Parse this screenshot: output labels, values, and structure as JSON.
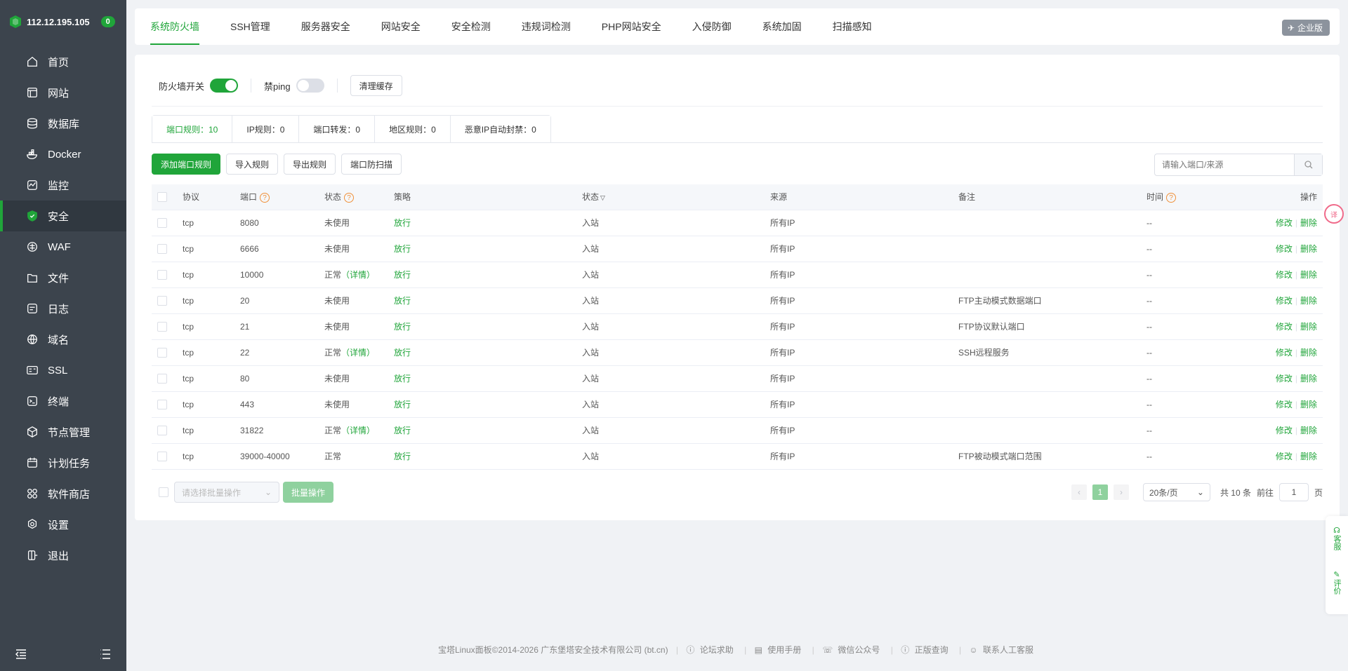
{
  "sidebar": {
    "ip": "112.12.195.105",
    "badge": "0",
    "items": [
      {
        "label": "首页",
        "icon": "home-icon"
      },
      {
        "label": "网站",
        "icon": "website-icon"
      },
      {
        "label": "数据库",
        "icon": "database-icon"
      },
      {
        "label": "Docker",
        "icon": "docker-icon"
      },
      {
        "label": "监控",
        "icon": "monitor-icon"
      },
      {
        "label": "安全",
        "icon": "shield-icon",
        "active": true
      },
      {
        "label": "WAF",
        "icon": "waf-icon"
      },
      {
        "label": "文件",
        "icon": "folder-icon"
      },
      {
        "label": "日志",
        "icon": "log-icon"
      },
      {
        "label": "域名",
        "icon": "globe-icon"
      },
      {
        "label": "SSL",
        "icon": "ssl-icon"
      },
      {
        "label": "终端",
        "icon": "terminal-icon"
      },
      {
        "label": "节点管理",
        "icon": "node-icon"
      },
      {
        "label": "计划任务",
        "icon": "calendar-icon"
      },
      {
        "label": "软件商店",
        "icon": "apps-icon"
      },
      {
        "label": "设置",
        "icon": "gear-icon"
      },
      {
        "label": "退出",
        "icon": "logout-icon"
      }
    ]
  },
  "topbar": {
    "tabs": [
      "系统防火墙",
      "SSH管理",
      "服务器安全",
      "网站安全",
      "安全检测",
      "违规词检测",
      "PHP网站安全",
      "入侵防御",
      "系统加固",
      "扫描感知"
    ],
    "active_tab": 0,
    "enterprise_label": "企业版"
  },
  "firewall": {
    "switch_label": "防火墙开关",
    "switch_on": true,
    "ping_label": "禁ping",
    "ping_on": false,
    "clear_cache": "清理缓存"
  },
  "subtabs": [
    "端口规则：10",
    "IP规则：0",
    "端口转发：0",
    "地区规则：0",
    "恶意IP自动封禁：0"
  ],
  "actions": {
    "add": "添加端口规则",
    "import": "导入规则",
    "export": "导出规则",
    "scan": "端口防扫描",
    "search_placeholder": "请输入端口/来源"
  },
  "table": {
    "headers": {
      "protocol": "协议",
      "port": "端口",
      "status": "状态",
      "policy": "策略",
      "direction": "状态",
      "source": "来源",
      "remark": "备注",
      "time": "时间",
      "ops": "操作"
    },
    "rows": [
      {
        "protocol": "tcp",
        "port": "8080",
        "status": "未使用",
        "detail": "",
        "policy": "放行",
        "direction": "入站",
        "source": "所有IP",
        "remark": "",
        "time": "--"
      },
      {
        "protocol": "tcp",
        "port": "6666",
        "status": "未使用",
        "detail": "",
        "policy": "放行",
        "direction": "入站",
        "source": "所有IP",
        "remark": "",
        "time": "--"
      },
      {
        "protocol": "tcp",
        "port": "10000",
        "status": "正常",
        "detail": "（详情）",
        "policy": "放行",
        "direction": "入站",
        "source": "所有IP",
        "remark": "",
        "time": "--"
      },
      {
        "protocol": "tcp",
        "port": "20",
        "status": "未使用",
        "detail": "",
        "policy": "放行",
        "direction": "入站",
        "source": "所有IP",
        "remark": "FTP主动模式数据端口",
        "time": "--"
      },
      {
        "protocol": "tcp",
        "port": "21",
        "status": "未使用",
        "detail": "",
        "policy": "放行",
        "direction": "入站",
        "source": "所有IP",
        "remark": "FTP协议默认端口",
        "time": "--"
      },
      {
        "protocol": "tcp",
        "port": "22",
        "status": "正常",
        "detail": "（详情）",
        "policy": "放行",
        "direction": "入站",
        "source": "所有IP",
        "remark": "SSH远程服务",
        "time": "--"
      },
      {
        "protocol": "tcp",
        "port": "80",
        "status": "未使用",
        "detail": "",
        "policy": "放行",
        "direction": "入站",
        "source": "所有IP",
        "remark": "",
        "time": "--"
      },
      {
        "protocol": "tcp",
        "port": "443",
        "status": "未使用",
        "detail": "",
        "policy": "放行",
        "direction": "入站",
        "source": "所有IP",
        "remark": "",
        "time": "--"
      },
      {
        "protocol": "tcp",
        "port": "31822",
        "status": "正常",
        "detail": "（详情）",
        "policy": "放行",
        "direction": "入站",
        "source": "所有IP",
        "remark": "",
        "time": "--"
      },
      {
        "protocol": "tcp",
        "port": "39000-40000",
        "status": "正常",
        "detail": "",
        "policy": "放行",
        "direction": "入站",
        "source": "所有IP",
        "remark": "FTP被动模式端口范围",
        "time": "--"
      }
    ],
    "edit": "修改",
    "delete": "删除"
  },
  "bottom": {
    "batch_placeholder": "请选择批量操作",
    "batch_btn": "批量操作",
    "page": "1",
    "page_size": "20条/页",
    "total": "共 10 条",
    "goto": "前往",
    "goto_value": "1",
    "page_unit": "页"
  },
  "footer": {
    "copyright": "宝塔Linux面板©2014-2026 广东堡塔安全技术有限公司 (bt.cn)",
    "links": [
      "论坛求助",
      "使用手册",
      "微信公众号",
      "正版查询",
      "联系人工客服"
    ]
  },
  "right_float": {
    "service": "客服",
    "review": "评价",
    "translate": "译"
  },
  "colors": {
    "accent": "#20a53a",
    "sidebar": "#3c444d",
    "warn": "#f0913a"
  }
}
